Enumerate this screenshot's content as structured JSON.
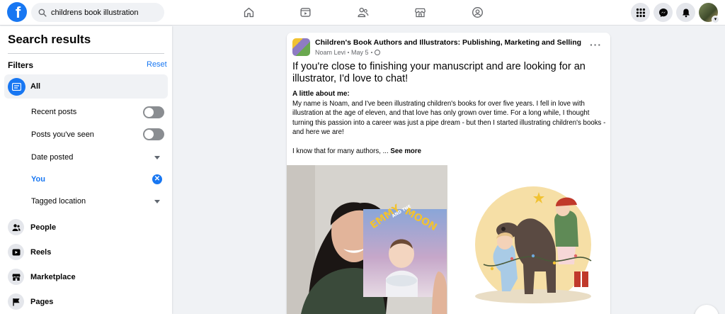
{
  "topbar": {
    "logo": "f",
    "search_value": "childrens book illustration",
    "nav_icons": [
      "home-icon",
      "video-icon",
      "friends-icon",
      "marketplace-icon",
      "groups-icon"
    ],
    "right_icons": [
      "menu-grid-icon",
      "messenger-icon",
      "bell-icon",
      "profile-avatar"
    ]
  },
  "sidebar": {
    "title": "Search results",
    "filters_label": "Filters",
    "reset_label": "Reset",
    "all_label": "All",
    "filters": [
      {
        "label": "Recent posts",
        "control": "toggle",
        "on": false
      },
      {
        "label": "Posts you've seen",
        "control": "toggle",
        "on": false
      },
      {
        "label": "Date posted",
        "control": "dropdown"
      },
      {
        "label": "You",
        "control": "clear",
        "active": true
      },
      {
        "label": "Tagged location",
        "control": "dropdown"
      }
    ],
    "categories": [
      {
        "label": "People",
        "icon": "people-icon"
      },
      {
        "label": "Reels",
        "icon": "reels-icon"
      },
      {
        "label": "Marketplace",
        "icon": "marketplace-icon"
      },
      {
        "label": "Pages",
        "icon": "pages-flag-icon"
      }
    ]
  },
  "post": {
    "group_name": "Children's Book Authors and Illustrators: Publishing, Marketing and Selling",
    "author": "Noam Levi",
    "date": "May 5",
    "headline": "If you're close to finishing your manuscript and are looking for an illustrator, I'd love to chat!",
    "about_heading": "A little about me:",
    "body": "My name is Noam, and I've been illustrating children's books for over five years. I fell in love with illustration at the age of eleven, and that love has only grown over time. For a long while, I thought turning this passion into a career was just a pipe dream - but then I started illustrating children's books - and here we are!",
    "closing": "I know that for many authors, ... ",
    "see_more": "See more",
    "book_title_1": "EMMY",
    "book_title_2": "AND THE",
    "book_title_3": "MOON"
  },
  "colors": {
    "accent": "#1877f2",
    "page_bg": "#f0f2f5",
    "text": "#050505",
    "secondary_text": "#65676b"
  }
}
